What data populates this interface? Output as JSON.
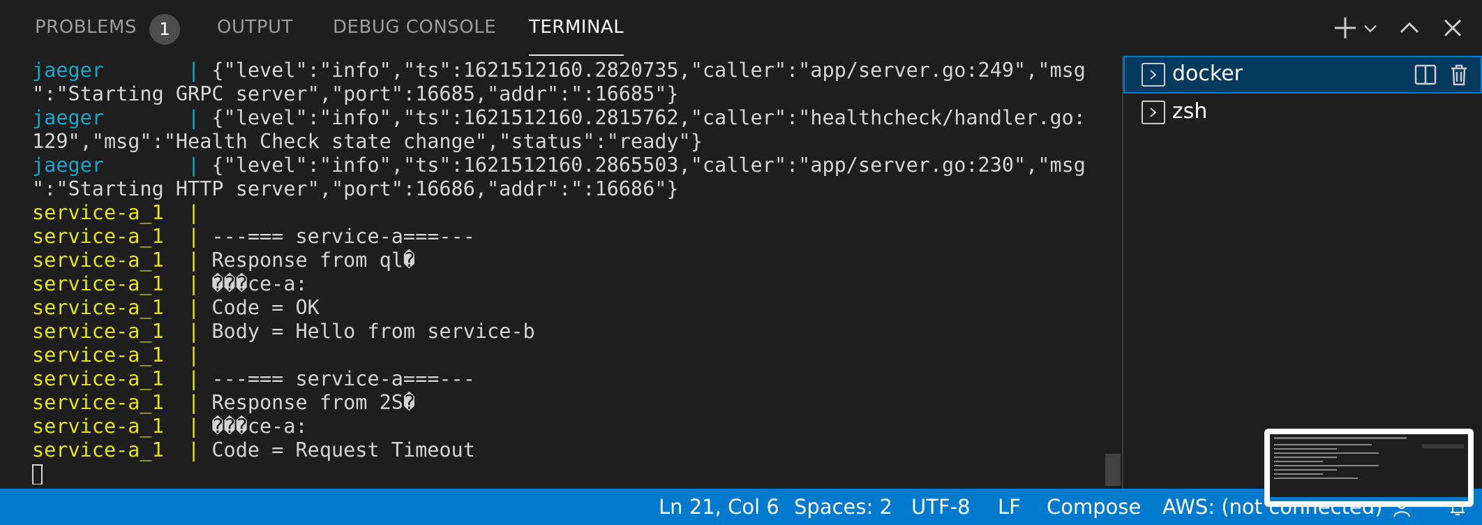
{
  "panel_tabs": {
    "problems": "PROBLEMS",
    "problems_count": "1",
    "output": "OUTPUT",
    "debug_console": "DEBUG CONSOLE",
    "terminal": "TERMINAL"
  },
  "toolbar_icons": [
    "plus-icon",
    "chevron-down-icon",
    "chevron-up-icon",
    "close-icon"
  ],
  "terminal_lines": [
    {
      "prefix": "jaeger       | ",
      "text": "{\"level\":\"info\",\"ts\":1621512160.2820735,\"caller\":\"app/server.go:249\",\"msg"
    },
    {
      "prefix": "",
      "text": "\":\"Starting GRPC server\",\"port\":16685,\"addr\":\":16685\"}"
    },
    {
      "prefix": "jaeger       | ",
      "text": "{\"level\":\"info\",\"ts\":1621512160.2815762,\"caller\":\"healthcheck/handler.go:"
    },
    {
      "prefix": "",
      "text": "129\",\"msg\":\"Health Check state change\",\"status\":\"ready\"}"
    },
    {
      "prefix": "jaeger       | ",
      "text": "{\"level\":\"info\",\"ts\":1621512160.2865503,\"caller\":\"app/server.go:230\",\"msg"
    },
    {
      "prefix": "",
      "text": "\":\"Starting HTTP server\",\"port\":16686,\"addr\":\":16686\"}"
    },
    {
      "prefix": "service-a_1  | ",
      "text": ""
    },
    {
      "prefix": "service-a_1  | ",
      "text": "---=== service-a===---"
    },
    {
      "prefix": "service-a_1  | ",
      "text": "Response from ql�"
    },
    {
      "prefix": "service-a_1  | ",
      "text": "���ce-a:"
    },
    {
      "prefix": "service-a_1  | ",
      "text": "Code = OK"
    },
    {
      "prefix": "service-a_1  | ",
      "text": "Body = Hello from service-b"
    },
    {
      "prefix": "service-a_1  | ",
      "text": ""
    },
    {
      "prefix": "service-a_1  | ",
      "text": "---=== service-a===---"
    },
    {
      "prefix": "service-a_1  | ",
      "text": "Response from 2S�"
    },
    {
      "prefix": "service-a_1  | ",
      "text": "���ce-a:"
    },
    {
      "prefix": "service-a_1  | ",
      "text": "Code = Request Timeout"
    }
  ],
  "colors": {
    "jaeger_prefix": "#11a8cd",
    "service_prefix": "#e5e510",
    "status_bar": "#007acc",
    "selected_terminal": "#04395e"
  },
  "terminal_list": [
    {
      "label": "docker",
      "selected": true
    },
    {
      "label": "zsh",
      "selected": false
    }
  ],
  "status_bar": {
    "position": "Ln 21, Col 6",
    "spaces": "Spaces: 2",
    "encoding": "UTF-8",
    "eol": "LF",
    "language": "Compose",
    "aws": "AWS: (not connected)"
  }
}
